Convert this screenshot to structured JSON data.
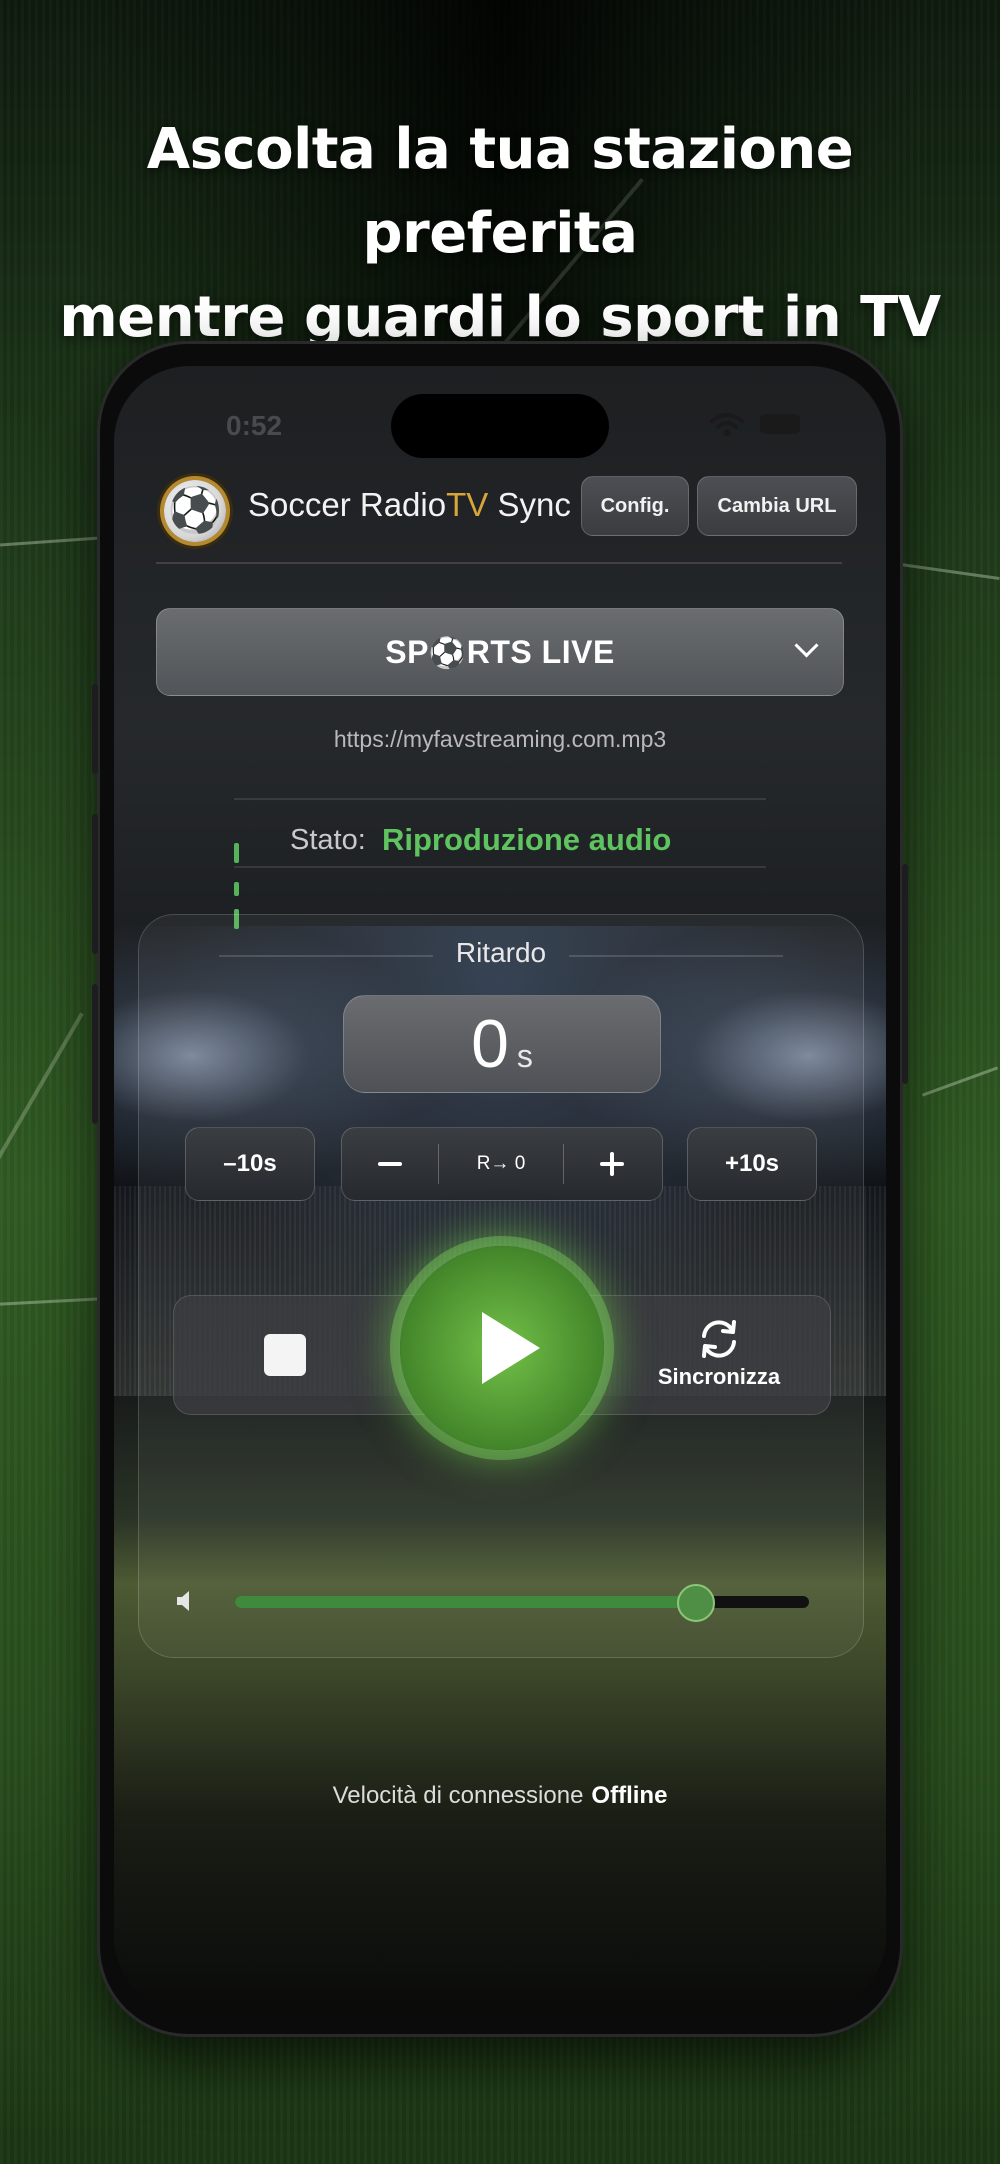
{
  "headline": {
    "line1": "Ascolta la tua stazione preferita",
    "line2": "mentre guardi lo sport in TV"
  },
  "status_bar": {
    "time": "0:52"
  },
  "app": {
    "title_part1": "Soccer Radio",
    "title_accent": "TV",
    "title_part2": " Sync",
    "config_label": "Config.",
    "change_url_label": "Cambia URL"
  },
  "station": {
    "name_prefix": "SP",
    "name_icon": "⚽",
    "name_suffix": "RTS LIVE",
    "url": "https://myfavstreaming.com.mp3"
  },
  "status": {
    "label": "Stato:",
    "value": "Riproduzione audio"
  },
  "delay": {
    "title": "Ritardo",
    "value": "0",
    "unit": "s",
    "minus10_label": "–10s",
    "reset_label": "R→ 0",
    "plus10_label": "+10s"
  },
  "transport": {
    "sync_label": "Sincronizza"
  },
  "volume": {
    "level": 0.8
  },
  "connection": {
    "label": "Velocità di connessione",
    "value": "Offline"
  },
  "colors": {
    "accent_gold": "#d9a53a",
    "status_green": "#5fc35f",
    "play_green": "#4d9230"
  },
  "icons": [
    "soccer-ball-logo-icon",
    "chevron-down-icon",
    "equalizer-icon",
    "minus-icon",
    "plus-icon",
    "stop-icon",
    "play-icon",
    "sync-icon",
    "speaker-icon",
    "wifi-icon",
    "battery-icon"
  ]
}
